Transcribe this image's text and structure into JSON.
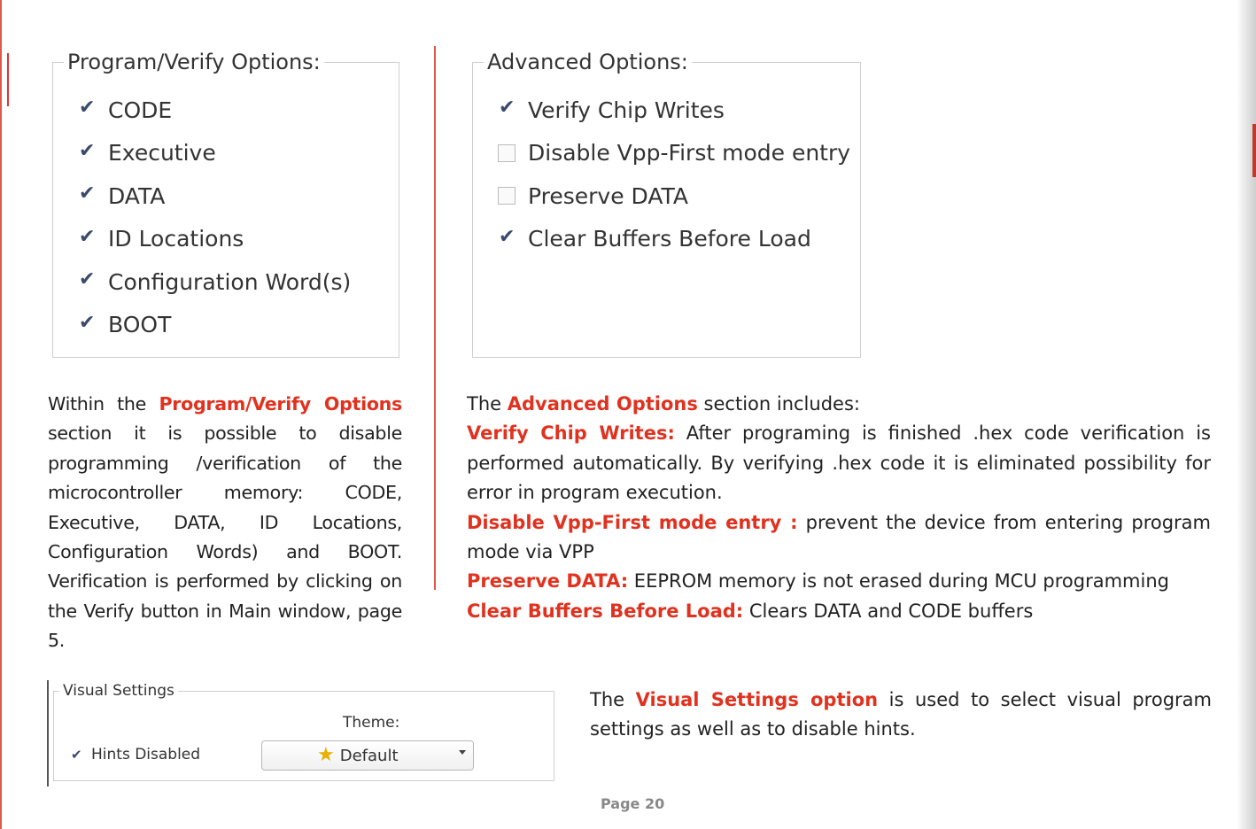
{
  "program_verify": {
    "legend": "Program/Verify Options:",
    "items": [
      {
        "label": "CODE",
        "checked": true
      },
      {
        "label": "Executive",
        "checked": true
      },
      {
        "label": "DATA",
        "checked": true
      },
      {
        "label": "ID Locations",
        "checked": true
      },
      {
        "label": "Configuration Word(s)",
        "checked": true
      },
      {
        "label": "BOOT",
        "checked": true
      }
    ]
  },
  "advanced": {
    "legend": "Advanced Options:",
    "items": [
      {
        "label": "Verify Chip Writes",
        "checked": true
      },
      {
        "label": "Disable Vpp-First mode entry",
        "checked": false
      },
      {
        "label": "Preserve DATA",
        "checked": false
      },
      {
        "label": "Clear Buffers Before Load",
        "checked": true
      }
    ]
  },
  "visual_settings": {
    "legend": "Visual Settings",
    "hints_label": "Hints Disabled",
    "hints_checked": true,
    "theme_label": "Theme:",
    "theme_value": "Default"
  },
  "text": {
    "p1_a": "Within the ",
    "p1_hl": "Program/Verify Options",
    "p1_b": " section it is possible to disable programming /verification of the microcontroller memory: CODE, Executive, DATA, ID Locations, Configuration Words) and BOOT. Verification is performed by clicking on the Verify button in Main window, page 5.",
    "adv_intro_a": "The ",
    "adv_intro_hl": "Advanced Options",
    "adv_intro_b": " section includes:",
    "verify_hl": "Verify Chip Writes:",
    "verify_text": " After programing is finished .hex code verification is performed automatically. By verifying .hex code it is eliminated possibility for error in program execution.",
    "vpp_hl": "Disable Vpp-First mode entry :",
    "vpp_text": " prevent the device from entering program mode via VPP",
    "preserve_hl": "Preserve DATA:",
    "preserve_text": " EEPROM memory is not erased during MCU programming",
    "clear_hl": "Clear Buffers Before Load:",
    "clear_text": " Clears DATA and CODE buffers",
    "vs_a": "The ",
    "vs_hl": "Visual Settings option",
    "vs_b": " is used to select visual program settings as well as to disable hints."
  },
  "page_number": "Page 20",
  "colors": {
    "accent": "#e0321f",
    "rule": "#e0584a"
  }
}
